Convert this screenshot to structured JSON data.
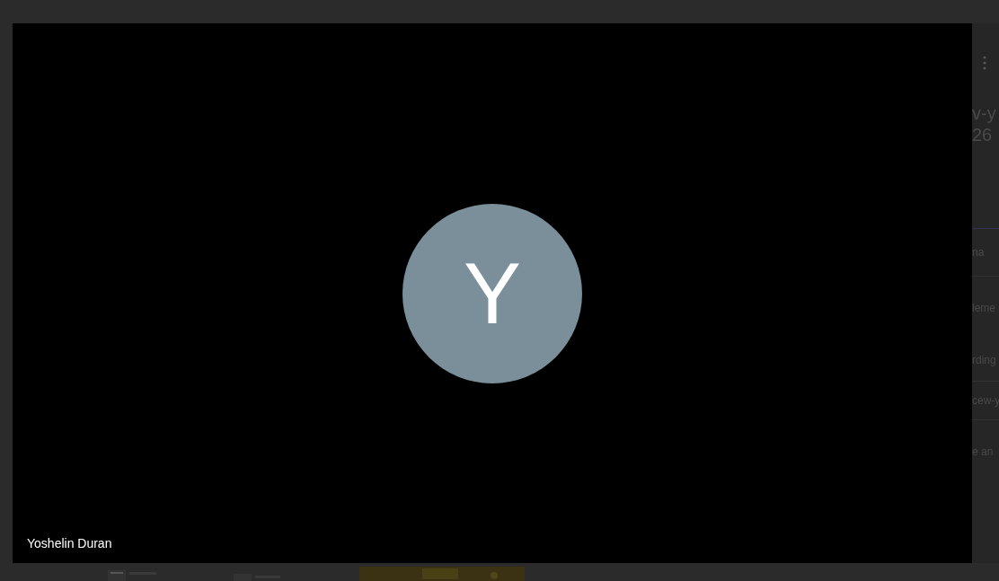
{
  "video": {
    "participant_name": "Yoshelin Duran",
    "avatar_initial": "Y"
  },
  "side_panel": {
    "title_lines": [
      "v-y",
      "26"
    ],
    "items": [
      "na",
      "leme",
      "rding",
      "cew-y",
      "e an"
    ]
  }
}
